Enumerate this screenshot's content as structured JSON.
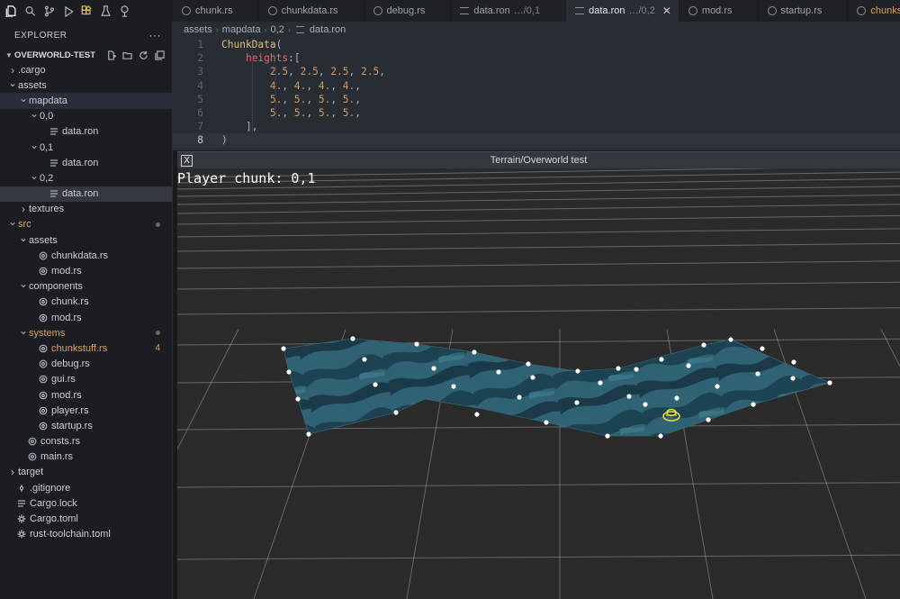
{
  "activity_bar": {
    "icons": [
      "files-icon",
      "search-icon",
      "source-control-icon",
      "run-debug-icon",
      "extensions-icon",
      "testing-icon",
      "remote-icon"
    ]
  },
  "explorer": {
    "title": "EXPLORER",
    "more": "···",
    "project": "OVERWORLD-TEST",
    "tree": [
      {
        "label": ".cargo",
        "indent": 1,
        "kind": "folder",
        "open": false
      },
      {
        "label": "assets",
        "indent": 1,
        "kind": "folder",
        "open": true
      },
      {
        "label": "mapdata",
        "indent": 2,
        "kind": "folder",
        "open": true,
        "state": "hover"
      },
      {
        "label": "0,0",
        "indent": 3,
        "kind": "folder",
        "open": true
      },
      {
        "label": "data.ron",
        "indent": 4,
        "kind": "file"
      },
      {
        "label": "0,1",
        "indent": 3,
        "kind": "folder",
        "open": true
      },
      {
        "label": "data.ron",
        "indent": 4,
        "kind": "file"
      },
      {
        "label": "0,2",
        "indent": 3,
        "kind": "folder",
        "open": true
      },
      {
        "label": "data.ron",
        "indent": 4,
        "kind": "file",
        "state": "selected"
      },
      {
        "label": "textures",
        "indent": 2,
        "kind": "folder",
        "open": false
      },
      {
        "label": "src",
        "indent": 1,
        "kind": "folder",
        "open": true,
        "color": "orange",
        "dot": true
      },
      {
        "label": "assets",
        "indent": 2,
        "kind": "folder",
        "open": true
      },
      {
        "label": "chunkdata.rs",
        "indent": 3,
        "kind": "rust"
      },
      {
        "label": "mod.rs",
        "indent": 3,
        "kind": "rust"
      },
      {
        "label": "components",
        "indent": 2,
        "kind": "folder",
        "open": true
      },
      {
        "label": "chunk.rs",
        "indent": 3,
        "kind": "rust"
      },
      {
        "label": "mod.rs",
        "indent": 3,
        "kind": "rust"
      },
      {
        "label": "systems",
        "indent": 2,
        "kind": "folder",
        "open": true,
        "color": "orange",
        "dot": true
      },
      {
        "label": "chunkstuff.rs",
        "indent": 3,
        "kind": "rust",
        "color": "orange",
        "badge": "4"
      },
      {
        "label": "debug.rs",
        "indent": 3,
        "kind": "rust"
      },
      {
        "label": "gui.rs",
        "indent": 3,
        "kind": "rust"
      },
      {
        "label": "mod.rs",
        "indent": 3,
        "kind": "rust"
      },
      {
        "label": "player.rs",
        "indent": 3,
        "kind": "rust"
      },
      {
        "label": "startup.rs",
        "indent": 3,
        "kind": "rust"
      },
      {
        "label": "consts.rs",
        "indent": 2,
        "kind": "rust"
      },
      {
        "label": "main.rs",
        "indent": 2,
        "kind": "rust"
      },
      {
        "label": "target",
        "indent": 1,
        "kind": "folder",
        "open": false
      },
      {
        "label": ".gitignore",
        "indent": 1,
        "kind": "git"
      },
      {
        "label": "Cargo.lock",
        "indent": 1,
        "kind": "file"
      },
      {
        "label": "Cargo.toml",
        "indent": 1,
        "kind": "gear"
      },
      {
        "label": "rust-toolchain.toml",
        "indent": 1,
        "kind": "gear"
      }
    ]
  },
  "tabs": [
    {
      "label": "chunk.rs",
      "icon": "rust"
    },
    {
      "label": "chunkdata.rs",
      "icon": "rust"
    },
    {
      "label": "debug.rs",
      "icon": "rust"
    },
    {
      "label": "data.ron",
      "sub": "…/0,1",
      "icon": "lines"
    },
    {
      "label": "data.ron",
      "sub": "…/0,2",
      "icon": "lines",
      "active": true,
      "close": "✕"
    },
    {
      "label": "mod.rs",
      "icon": "rust"
    },
    {
      "label": "startup.rs",
      "icon": "rust"
    },
    {
      "label": "chunkstuff.rs",
      "icon": "rust",
      "color": "orange"
    }
  ],
  "breadcrumb": [
    "assets",
    "mapdata",
    "0,2",
    "data.ron"
  ],
  "editor": {
    "current_line": 8,
    "lines": [
      [
        {
          "t": "ChunkData",
          "c": "type"
        },
        {
          "t": "(",
          "c": "punct"
        }
      ],
      [
        {
          "t": "    "
        },
        {
          "t": "heights",
          "c": "field"
        },
        {
          "t": ":[",
          "c": "punct"
        }
      ],
      [
        {
          "t": "        "
        },
        {
          "t": "2.5",
          "c": "num"
        },
        {
          "t": ", ",
          "c": "punct"
        },
        {
          "t": "2.5",
          "c": "num"
        },
        {
          "t": ", ",
          "c": "punct"
        },
        {
          "t": "2.5",
          "c": "num"
        },
        {
          "t": ", ",
          "c": "punct"
        },
        {
          "t": "2.5",
          "c": "num"
        },
        {
          "t": ",",
          "c": "punct"
        }
      ],
      [
        {
          "t": "        "
        },
        {
          "t": "4.",
          "c": "num"
        },
        {
          "t": ", ",
          "c": "punct"
        },
        {
          "t": "4.",
          "c": "num"
        },
        {
          "t": ", ",
          "c": "punct"
        },
        {
          "t": "4.",
          "c": "num"
        },
        {
          "t": ", ",
          "c": "punct"
        },
        {
          "t": "4.",
          "c": "num"
        },
        {
          "t": ",",
          "c": "punct"
        }
      ],
      [
        {
          "t": "        "
        },
        {
          "t": "5.",
          "c": "num"
        },
        {
          "t": ", ",
          "c": "punct"
        },
        {
          "t": "5.",
          "c": "num"
        },
        {
          "t": ", ",
          "c": "punct"
        },
        {
          "t": "5.",
          "c": "num"
        },
        {
          "t": ", ",
          "c": "punct"
        },
        {
          "t": "5.",
          "c": "num"
        },
        {
          "t": ",",
          "c": "punct"
        }
      ],
      [
        {
          "t": "        "
        },
        {
          "t": "5.",
          "c": "num"
        },
        {
          "t": ", ",
          "c": "punct"
        },
        {
          "t": "5.",
          "c": "num"
        },
        {
          "t": ", ",
          "c": "punct"
        },
        {
          "t": "5.",
          "c": "num"
        },
        {
          "t": ", ",
          "c": "punct"
        },
        {
          "t": "5.",
          "c": "num"
        },
        {
          "t": ",",
          "c": "punct"
        }
      ],
      [
        {
          "t": "    "
        },
        {
          "t": "],",
          "c": "punct"
        }
      ],
      [
        {
          "t": ")",
          "c": "punct"
        }
      ]
    ]
  },
  "game_window": {
    "close_glyph": "X",
    "title": "Terrain/Overworld test",
    "hud": "Player chunk: 0,1"
  },
  "colors": {
    "orange": "#e0a156",
    "terrain_light": "#2f6070",
    "terrain_dark": "#1b3e4c",
    "player_marker": "#e6e02a"
  }
}
